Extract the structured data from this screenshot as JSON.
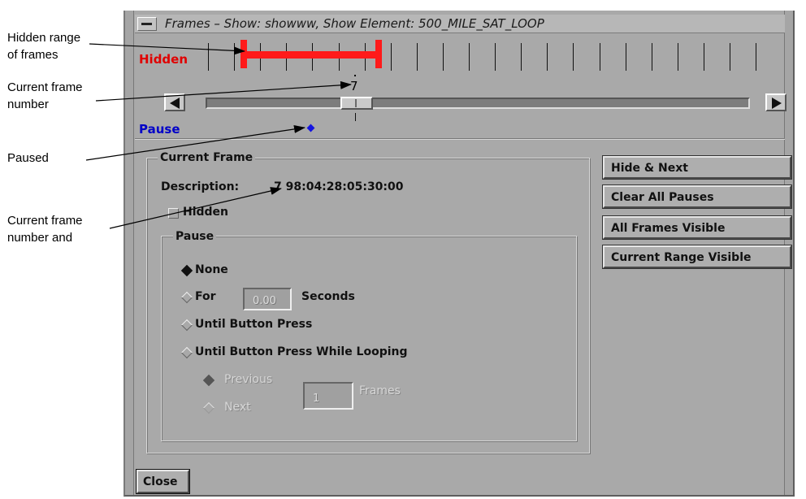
{
  "callouts": {
    "hidden_range": [
      "Hidden range",
      "of frames"
    ],
    "current_frame_number": [
      "Current frame",
      "number"
    ],
    "paused": [
      "Paused"
    ],
    "current_frame_number_and": [
      "Current frame",
      "number and"
    ]
  },
  "window": {
    "title": "Frames – Show: showww, Show Element: 500_MILE_SAT_LOOP"
  },
  "timeline": {
    "hidden_label": "Hidden",
    "pause_label": "Pause",
    "current_frame": "7",
    "hidden_color": "#ff1a1a",
    "pause_color": "#0000c8"
  },
  "current_frame_group": {
    "title": "Current Frame",
    "description_label": "Description:",
    "description_value": "7 98:04:28:05:30:00",
    "hidden_checkbox": "Hidden",
    "hidden_checked": false
  },
  "pause_group": {
    "title": "Pause",
    "options": [
      {
        "label": "None",
        "selected": true
      },
      {
        "label": "For",
        "selected": false
      },
      {
        "label": "Until Button Press",
        "selected": false
      },
      {
        "label": "Until Button Press While Looping",
        "selected": false
      }
    ],
    "seconds_value": "0.00",
    "seconds_label": "Seconds",
    "sub_options": [
      {
        "label": "Previous",
        "selected": true,
        "enabled": false
      },
      {
        "label": "Next",
        "selected": false,
        "enabled": false
      }
    ],
    "frames_value": "1",
    "frames_label": "Frames"
  },
  "buttons": {
    "hide_next": "Hide & Next",
    "clear_all_pauses": "Clear All Pauses",
    "all_frames_visible": "All Frames Visible",
    "current_range_visible": "Current Range Visible",
    "close": "Close"
  },
  "icons": {
    "window_menu": "window-menu-icon",
    "previous": "left-arrow-icon",
    "next": "right-arrow-icon",
    "pause_marker": "diamond-icon"
  }
}
